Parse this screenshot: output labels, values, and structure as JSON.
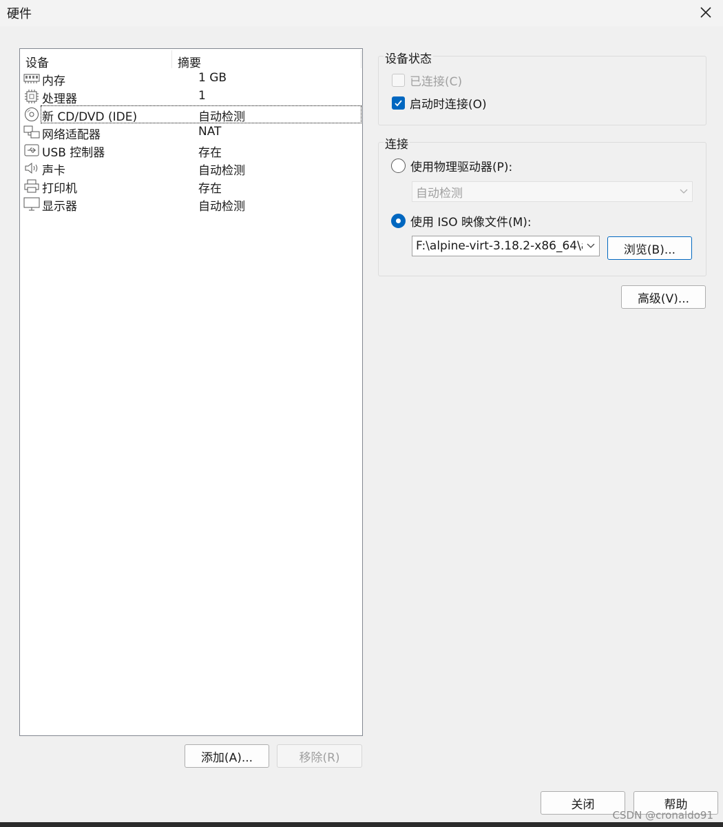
{
  "window": {
    "title": "硬件"
  },
  "devices": {
    "col_device": "设备",
    "col_summary": "摘要",
    "items": [
      {
        "icon": "memory-icon",
        "name": "内存",
        "summary": "1 GB"
      },
      {
        "icon": "processor-icon",
        "name": "处理器",
        "summary": "1"
      },
      {
        "icon": "cd-dvd-icon",
        "name": "新 CD/DVD (IDE)",
        "summary": "自动检测"
      },
      {
        "icon": "network-adapter-icon",
        "name": "网络适配器",
        "summary": "NAT"
      },
      {
        "icon": "usb-icon",
        "name": "USB 控制器",
        "summary": "存在"
      },
      {
        "icon": "sound-icon",
        "name": "声卡",
        "summary": "自动检测"
      },
      {
        "icon": "printer-icon",
        "name": "打印机",
        "summary": "存在"
      },
      {
        "icon": "display-icon",
        "name": "显示器",
        "summary": "自动检测"
      }
    ],
    "selected": "新 CD/DVD (IDE)"
  },
  "buttons": {
    "add": "添加(A)...",
    "remove": "移除(R)",
    "browse": "浏览(B)...",
    "advanced": "高级(V)...",
    "close": "关闭",
    "help": "帮助"
  },
  "status_group": {
    "label": "设备状态",
    "connected": {
      "label": "已连接(C)",
      "checked": false,
      "disabled": true
    },
    "connect_at_power_on": {
      "label": "启动时连接(O)",
      "checked": true
    }
  },
  "connection_group": {
    "label": "连接",
    "physical": {
      "label": "使用物理驱动器(P):",
      "selected": false
    },
    "physical_value": "自动检测",
    "iso": {
      "label": "使用 ISO 映像文件(M):",
      "selected": true
    },
    "iso_path": "F:\\alpine-virt-3.18.2-x86_64\\a"
  },
  "colors": {
    "accent": "#0067c0",
    "disabled_text": "#a0a0a0"
  },
  "watermark": "CSDN @cronaldo91"
}
